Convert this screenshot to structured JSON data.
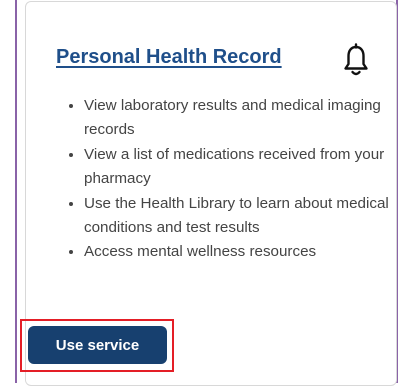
{
  "card": {
    "title": "Personal Health Record",
    "notification_icon": "bell-icon",
    "features": [
      "View laboratory results and medical imaging records",
      "View a list of medications received from your pharmacy",
      "Use the Health Library to learn about medical conditions and test results",
      "Access mental wellness resources"
    ],
    "cta_label": "Use service"
  },
  "colors": {
    "title": "#1f4f8a",
    "button_bg": "#17406f",
    "button_text": "#ffffff",
    "focus_outline": "#e41e26",
    "outer_border": "#8a63a8",
    "body_text": "#444444"
  }
}
